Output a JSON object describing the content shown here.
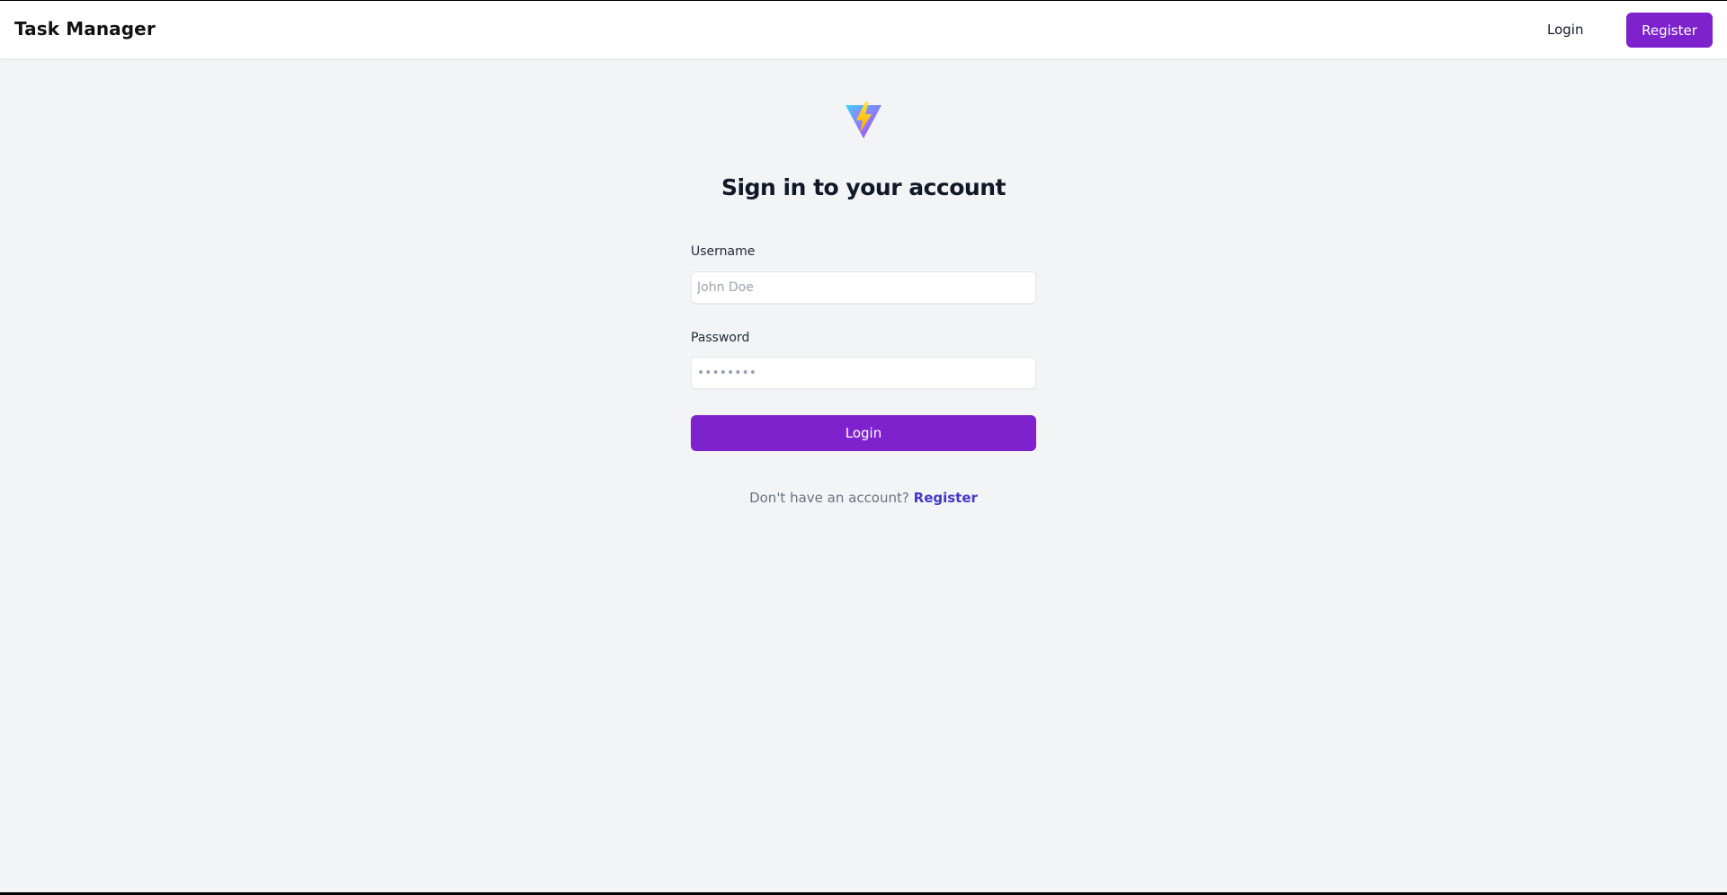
{
  "navbar": {
    "brand": "Task Manager",
    "login_label": "Login",
    "register_label": "Register"
  },
  "logo": {
    "icon": "vite-logo-icon"
  },
  "form": {
    "title": "Sign in to your account",
    "username_label": "Username",
    "username_placeholder": "John Doe",
    "username_value": "",
    "password_label": "Password",
    "password_placeholder": "••••••••",
    "password_value": "",
    "submit_label": "Login"
  },
  "footer_prompt": {
    "text": "Don't have an account?",
    "link_label": "Register"
  },
  "colors": {
    "accent": "#7e22ce",
    "link": "#4338ca",
    "background": "#f3f4f6"
  }
}
